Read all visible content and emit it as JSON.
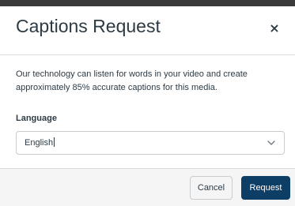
{
  "dialog": {
    "title": "Captions Request",
    "close_glyph": "×",
    "description": "Our technology can listen for words in your video and create approximately 85% accurate captions for this media.",
    "language": {
      "label": "Language",
      "value": "English",
      "icon": "chevron-down-icon"
    },
    "cancel_label": "Cancel",
    "request_label": "Request"
  },
  "colors": {
    "text": "#2d3b45",
    "primary_button": "#0d3e66",
    "footer_bg": "#f5f5f5",
    "border": "#c7cdd1"
  }
}
